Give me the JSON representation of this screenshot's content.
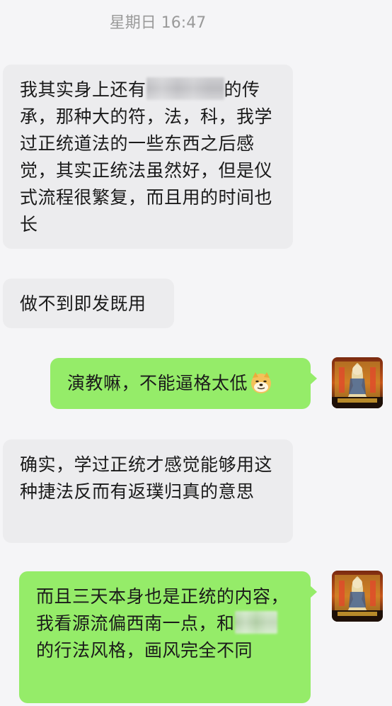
{
  "chat": {
    "timestamp": "星期日 16:47",
    "messages": [
      {
        "side": "incoming",
        "text_before_blur": "我其实身上还有",
        "text_after_blur": "的传承，那种大的符，法，科，我学过正统道法的一些东西之后感觉，其实正统法虽然好，但是仪式流程很繁复，而且用的时间也长"
      },
      {
        "side": "incoming",
        "text": "做不到即发既用"
      },
      {
        "side": "outgoing",
        "text": "演教嘛，不能逼格太低",
        "emoji": "doge-emoji"
      },
      {
        "side": "incoming",
        "text": "确实，学过正统才感觉能够用这种捷法反而有返璞归真的意思"
      },
      {
        "side": "outgoing",
        "text_before_blur": "而且三天本身也是正统的内容，我看源流偏西南一点，和",
        "text_after_blur": "的行法风格，画风完全不同"
      }
    ]
  },
  "colors": {
    "incoming_bubble": "#ececee",
    "outgoing_bubble": "#95ec69",
    "background": "#f5f5f7",
    "timestamp_text": "#9a9a9a"
  }
}
